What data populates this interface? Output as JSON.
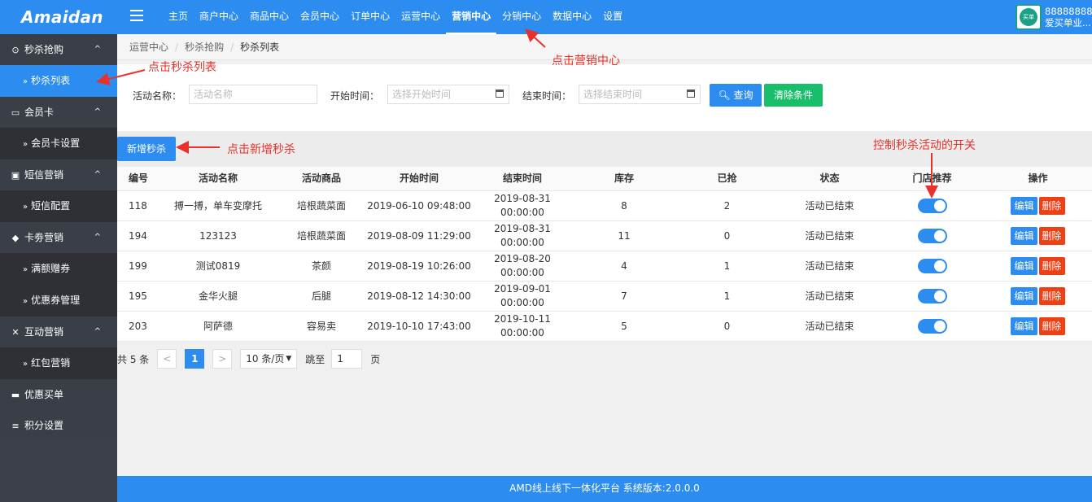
{
  "header": {
    "logo": "Amaidan",
    "nav": [
      "主页",
      "商户中心",
      "商品中心",
      "会员中心",
      "订单中心",
      "运营中心",
      "营销中心",
      "分销中心",
      "数据中心",
      "设置"
    ],
    "active_nav": "营销中心",
    "user_id": "88888888",
    "user_name": "爱买单业...",
    "avatar_text": "买单"
  },
  "sidebar": {
    "groups": [
      {
        "label": "秒杀抢购",
        "icon": "clock-icon",
        "subs": [
          "秒杀列表"
        ]
      },
      {
        "label": "会员卡",
        "icon": "card-icon",
        "subs": [
          "会员卡设置"
        ]
      },
      {
        "label": "短信营销",
        "icon": "sms-icon",
        "subs": [
          "短信配置"
        ]
      },
      {
        "label": "卡劵营销",
        "icon": "tag-icon",
        "subs": [
          "满额赠券",
          "优惠券管理"
        ]
      },
      {
        "label": "互动营销",
        "icon": "expand-icon",
        "subs": [
          "红包营销"
        ]
      },
      {
        "label": "优惠买单",
        "icon": "briefcase-icon",
        "subs": []
      },
      {
        "label": "积分设置",
        "icon": "database-icon",
        "subs": []
      }
    ],
    "active_sub": "秒杀列表"
  },
  "breadcrumb": [
    "运营中心",
    "秒杀抢购",
    "秒杀列表"
  ],
  "filter": {
    "name_label": "活动名称：",
    "name_placeholder": "活动名称",
    "start_label": "开始时间：",
    "start_placeholder": "选择开始时间",
    "end_label": "结束时间：",
    "end_placeholder": "选择结束时间",
    "query_button": "查询",
    "clear_button": "清除条件"
  },
  "add_button": "新增秒杀",
  "table": {
    "headers": [
      "编号",
      "活动名称",
      "活动商品",
      "开始时间",
      "结束时间",
      "库存",
      "已抢",
      "状态",
      "门店推荐",
      "操作"
    ],
    "rows": [
      {
        "id": "118",
        "name": "搏一搏，单车变摩托",
        "product": "培根蔬菜面",
        "start": "2019-06-10 09:48:00",
        "end": "2019-08-31 00:00:00",
        "stock": "8",
        "sold": "2",
        "status": "活动已结束",
        "recommend": true
      },
      {
        "id": "194",
        "name": "123123",
        "product": "培根蔬菜面",
        "start": "2019-08-09 11:29:00",
        "end": "2019-08-31 00:00:00",
        "stock": "11",
        "sold": "0",
        "status": "活动已结束",
        "recommend": true
      },
      {
        "id": "199",
        "name": "测试0819",
        "product": "茶颜",
        "start": "2019-08-19 10:26:00",
        "end": "2019-08-20 00:00:00",
        "stock": "4",
        "sold": "1",
        "status": "活动已结束",
        "recommend": true
      },
      {
        "id": "195",
        "name": "金华火腿",
        "product": "后腿",
        "start": "2019-08-12 14:30:00",
        "end": "2019-09-01 00:00:00",
        "stock": "7",
        "sold": "1",
        "status": "活动已结束",
        "recommend": true
      },
      {
        "id": "203",
        "name": "阿萨德",
        "product": "容易卖",
        "start": "2019-10-10 17:43:00",
        "end": "2019-10-11 00:00:00",
        "stock": "5",
        "sold": "0",
        "status": "活动已结束",
        "recommend": true
      }
    ],
    "edit_label": "编辑",
    "delete_label": "删除"
  },
  "pager": {
    "total": "共 5 条",
    "prev": "<",
    "current": "1",
    "next": ">",
    "page_size": "10 条/页",
    "jump_label": "跳至",
    "jump_value": "1",
    "page_unit": "页"
  },
  "footer": "AMD线上线下一体化平台 系统版本:2.0.0.0",
  "annotations": {
    "click_list": "点击秒杀列表",
    "click_marketing": "点击营销中心",
    "click_add": "点击新增秒杀",
    "toggle_hint": "控制秒杀活动的开关"
  },
  "colors": {
    "primary": "#2d8cf0",
    "success": "#19be6b",
    "danger": "#ed4014",
    "sidebar": "#3c4049",
    "annotation": "#e8312a"
  }
}
